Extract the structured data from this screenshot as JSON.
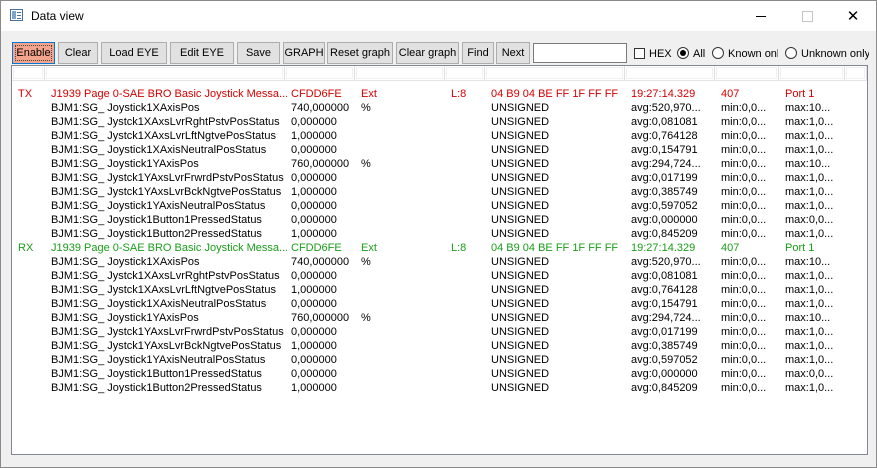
{
  "window": {
    "title": "Data view",
    "minimize": "minimize",
    "maximize": "maximize",
    "close": "close"
  },
  "toolbar": {
    "buttons": [
      "Enable",
      "Clear",
      "Load EYE",
      "Edit EYE",
      "Save",
      "GRAPH",
      "Reset graph",
      "Clear graph",
      "Find",
      "Next"
    ],
    "search_value": "",
    "hex_label": "HEX",
    "hex_checked": false,
    "radio_all": "All",
    "radio_known": "Known only",
    "radio_unknown": "Unknown only",
    "selected_filter": "All"
  },
  "colors": {
    "tx": "#d40000",
    "rx": "#1a9e1a",
    "enable_active": "#f4a48c"
  },
  "messages": [
    {
      "dir": "TX",
      "name": "J1939 Page 0-SAE BRO Basic Joystick Messa...",
      "id": "CFDD6FE",
      "frame": "Ext",
      "len": "L:8",
      "data": "04 B9 04 BE FF 1F FF FF",
      "time": "19:27:14.329",
      "count": "407",
      "port": "Port 1",
      "signals": [
        {
          "name": "BJM1:SG_ Joystick1XAxisPos",
          "value": "740,000000",
          "unit": "%",
          "type": "UNSIGNED",
          "avg": "avg:520,970...",
          "min": "min:0,0...",
          "max": "max:10..."
        },
        {
          "name": "BJM1:SG_ Jystck1XAxsLvrRghtPstvPosStatus",
          "value": "0,000000",
          "unit": "",
          "type": "UNSIGNED",
          "avg": "avg:0,081081",
          "min": "min:0,0...",
          "max": "max:1,0..."
        },
        {
          "name": "BJM1:SG_ Jystck1XAxsLvrLftNgtvePosStatus",
          "value": "1,000000",
          "unit": "",
          "type": "UNSIGNED",
          "avg": "avg:0,764128",
          "min": "min:0,0...",
          "max": "max:1,0..."
        },
        {
          "name": "BJM1:SG_ Joystick1XAxisNeutralPosStatus",
          "value": "0,000000",
          "unit": "",
          "type": "UNSIGNED",
          "avg": "avg:0,154791",
          "min": "min:0,0...",
          "max": "max:1,0..."
        },
        {
          "name": "BJM1:SG_ Joystick1YAxisPos",
          "value": "760,000000",
          "unit": "%",
          "type": "UNSIGNED",
          "avg": "avg:294,724...",
          "min": "min:0,0...",
          "max": "max:10..."
        },
        {
          "name": "BJM1:SG_ Jystck1YAxsLvrFrwrdPstvPosStatus",
          "value": "0,000000",
          "unit": "",
          "type": "UNSIGNED",
          "avg": "avg:0,017199",
          "min": "min:0,0...",
          "max": "max:1,0..."
        },
        {
          "name": "BJM1:SG_ Jystck1YAxsLvrBckNgtvePosStatus",
          "value": "1,000000",
          "unit": "",
          "type": "UNSIGNED",
          "avg": "avg:0,385749",
          "min": "min:0,0...",
          "max": "max:1,0..."
        },
        {
          "name": "BJM1:SG_ Joystick1YAxisNeutralPosStatus",
          "value": "0,000000",
          "unit": "",
          "type": "UNSIGNED",
          "avg": "avg:0,597052",
          "min": "min:0,0...",
          "max": "max:1,0..."
        },
        {
          "name": "BJM1:SG_ Joystick1Button1PressedStatus",
          "value": "0,000000",
          "unit": "",
          "type": "UNSIGNED",
          "avg": "avg:0,000000",
          "min": "min:0,0...",
          "max": "max:0,0..."
        },
        {
          "name": "BJM1:SG_ Joystick1Button2PressedStatus",
          "value": "1,000000",
          "unit": "",
          "type": "UNSIGNED",
          "avg": "avg:0,845209",
          "min": "min:0,0...",
          "max": "max:1,0..."
        }
      ]
    },
    {
      "dir": "RX",
      "name": "J1939 Page 0-SAE BRO Basic Joystick Messa...",
      "id": "CFDD6FE",
      "frame": "Ext",
      "len": "L:8",
      "data": "04 B9 04 BE FF 1F FF FF",
      "time": "19:27:14.329",
      "count": "407",
      "port": "Port 1",
      "signals": [
        {
          "name": "BJM1:SG_ Joystick1XAxisPos",
          "value": "740,000000",
          "unit": "%",
          "type": "UNSIGNED",
          "avg": "avg:520,970...",
          "min": "min:0,0...",
          "max": "max:10..."
        },
        {
          "name": "BJM1:SG_ Jystck1XAxsLvrRghtPstvPosStatus",
          "value": "0,000000",
          "unit": "",
          "type": "UNSIGNED",
          "avg": "avg:0,081081",
          "min": "min:0,0...",
          "max": "max:1,0..."
        },
        {
          "name": "BJM1:SG_ Jystck1XAxsLvrLftNgtvePosStatus",
          "value": "1,000000",
          "unit": "",
          "type": "UNSIGNED",
          "avg": "avg:0,764128",
          "min": "min:0,0...",
          "max": "max:1,0..."
        },
        {
          "name": "BJM1:SG_ Joystick1XAxisNeutralPosStatus",
          "value": "0,000000",
          "unit": "",
          "type": "UNSIGNED",
          "avg": "avg:0,154791",
          "min": "min:0,0...",
          "max": "max:1,0..."
        },
        {
          "name": "BJM1:SG_ Joystick1YAxisPos",
          "value": "760,000000",
          "unit": "%",
          "type": "UNSIGNED",
          "avg": "avg:294,724...",
          "min": "min:0,0...",
          "max": "max:10..."
        },
        {
          "name": "BJM1:SG_ Jystck1YAxsLvrFrwrdPstvPosStatus",
          "value": "0,000000",
          "unit": "",
          "type": "UNSIGNED",
          "avg": "avg:0,017199",
          "min": "min:0,0...",
          "max": "max:1,0..."
        },
        {
          "name": "BJM1:SG_ Jystck1YAxsLvrBckNgtvePosStatus",
          "value": "1,000000",
          "unit": "",
          "type": "UNSIGNED",
          "avg": "avg:0,385749",
          "min": "min:0,0...",
          "max": "max:1,0..."
        },
        {
          "name": "BJM1:SG_ Joystick1YAxisNeutralPosStatus",
          "value": "0,000000",
          "unit": "",
          "type": "UNSIGNED",
          "avg": "avg:0,597052",
          "min": "min:0,0...",
          "max": "max:1,0..."
        },
        {
          "name": "BJM1:SG_ Joystick1Button1PressedStatus",
          "value": "0,000000",
          "unit": "",
          "type": "UNSIGNED",
          "avg": "avg:0,000000",
          "min": "min:0,0...",
          "max": "max:0,0..."
        },
        {
          "name": "BJM1:SG_ Joystick1Button2PressedStatus",
          "value": "1,000000",
          "unit": "",
          "type": "UNSIGNED",
          "avg": "avg:0,845209",
          "min": "min:0,0...",
          "max": "max:1,0..."
        }
      ]
    }
  ]
}
